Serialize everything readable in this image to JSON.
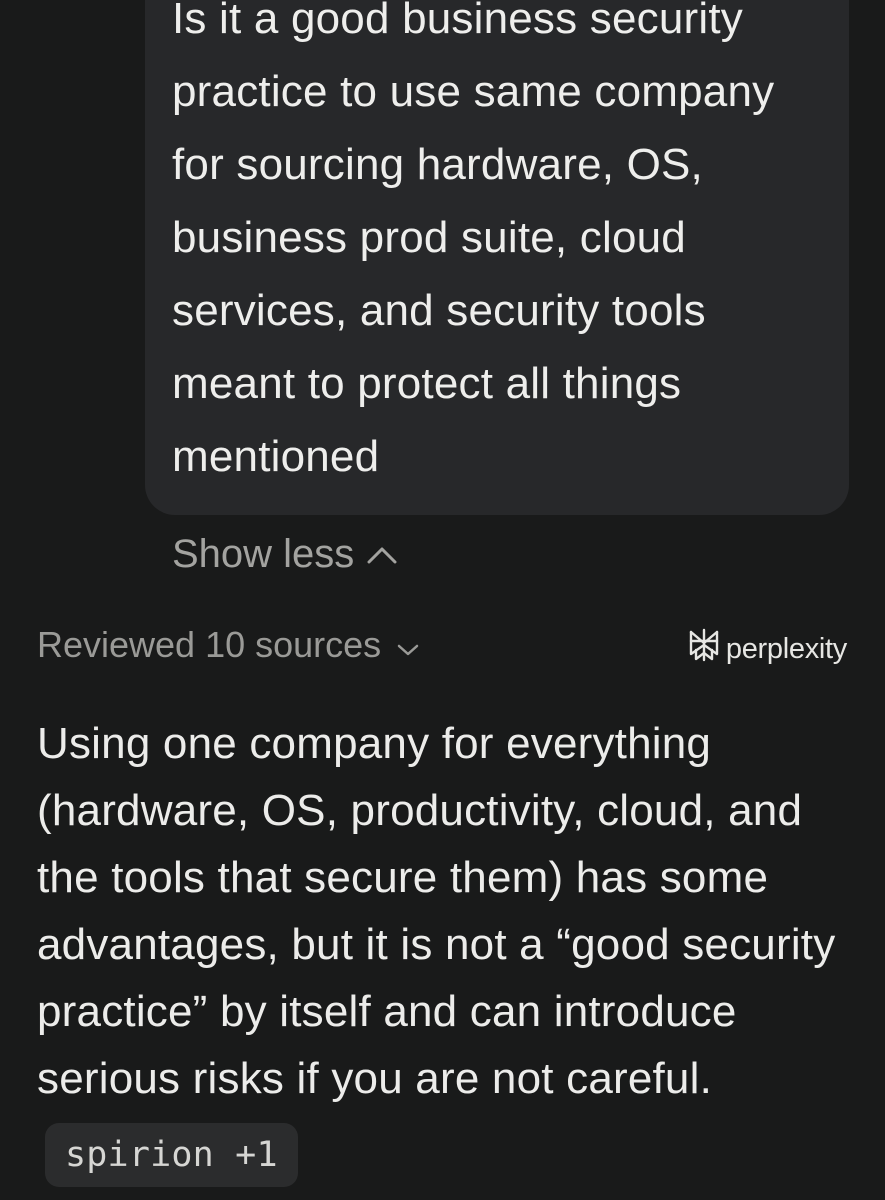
{
  "query": {
    "text": "Is it a good business security practice to use same company for sourcing hardware, OS, business prod suite, cloud services, and security tools meant to protect all things mentioned",
    "toggle_label": "Show less",
    "toggle_icon": "chevron-up-icon"
  },
  "sources": {
    "label": "Reviewed 10 sources",
    "icon": "chevron-down-icon"
  },
  "brand": {
    "name": "perplexity",
    "icon": "perplexity-logo"
  },
  "answer": {
    "text": "Using one company for everything (hardware, OS, productivity, cloud, and the tools that secure them) has some advantages, but it is not a “good security practice” by itself and can introduce serious risks if you are not careful.",
    "citation": "spirion +1"
  },
  "colors": {
    "background": "#191a1a",
    "bubble": "#27282a",
    "muted_text": "#9a9a97",
    "citation_bg": "#2b2c2d"
  }
}
